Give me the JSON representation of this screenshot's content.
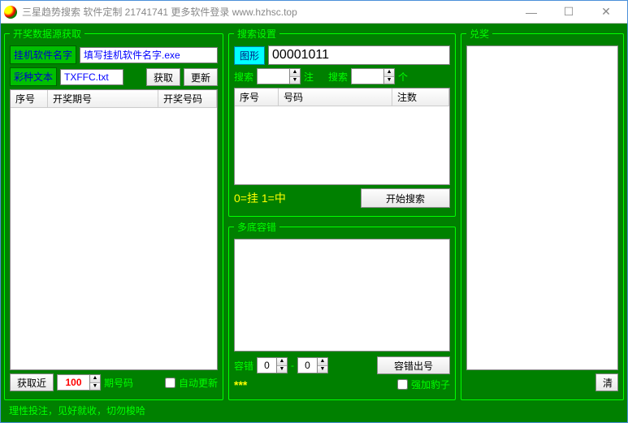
{
  "window": {
    "title": "三星趋势搜索 软件定制 21741741 更多软件登录 www.hzhsc.top"
  },
  "panel_data": {
    "legend": "开奖数据源获取",
    "soft_name_label": "挂机软件名字",
    "soft_name_value": "填写挂机软件名字.exe",
    "lottery_label": "彩种文本",
    "lottery_value": "TXFFC.txt",
    "btn_fetch": "获取",
    "btn_update": "更新",
    "cols": {
      "seq": "序号",
      "period": "开奖期号",
      "number": "开奖号码"
    },
    "near_label": "获取近",
    "near_value": "100",
    "period_suffix": "期号码",
    "auto_update": "自动更新"
  },
  "panel_search": {
    "legend": "搜索设置",
    "shape_label": "图形",
    "shape_value": "00001011",
    "search_label": "搜索",
    "zhu": "注",
    "ge": "个",
    "search_val_a": "",
    "search_val_b": "",
    "cols": {
      "seq": "序号",
      "num": "号码",
      "bet": "注数"
    },
    "legend_hint": "0=挂  1=中",
    "btn_start": "开始搜索",
    "fault": {
      "legend": "多底容错",
      "text": "",
      "fault_label": "容错",
      "val_a": "0",
      "val_b": "0",
      "btn_output": "容错出号",
      "stars": "***",
      "force_leopard": "强加豹子"
    }
  },
  "panel_redeem": {
    "legend": "兑奖",
    "btn_clear": "清"
  },
  "footer": "理性投注，见好就收，切勿梭哈"
}
